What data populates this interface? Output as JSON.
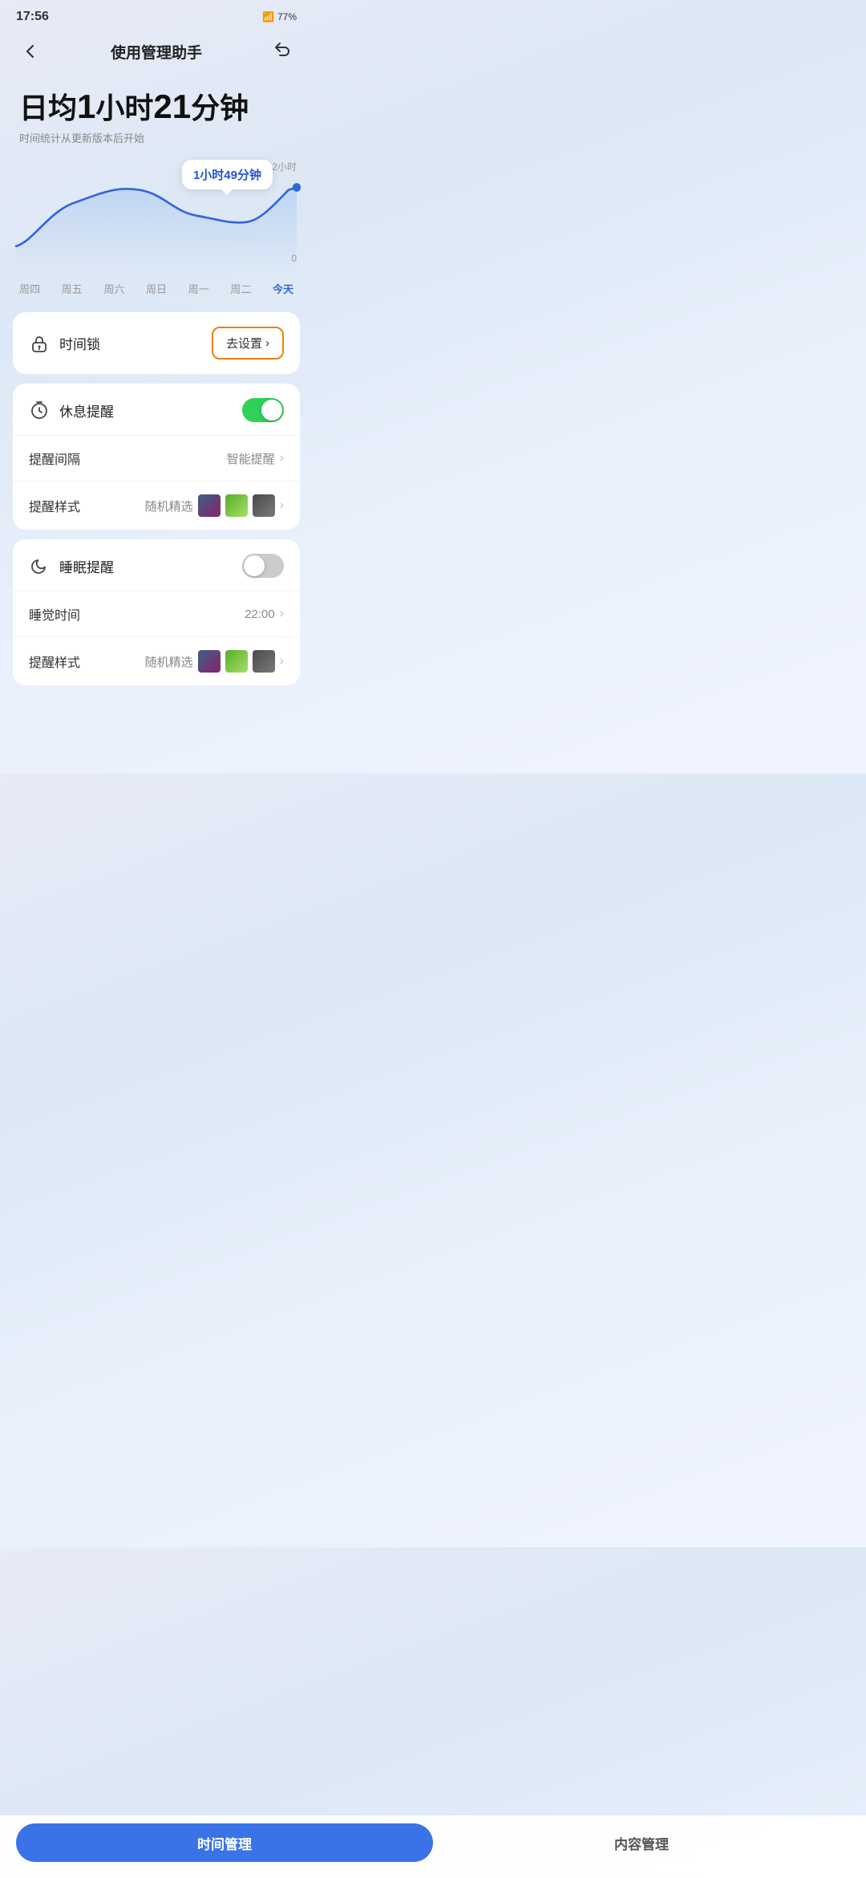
{
  "statusBar": {
    "time": "17:56",
    "battery": "77%"
  },
  "header": {
    "title": "使用管理助手",
    "backLabel": "‹",
    "shareLabel": "↗"
  },
  "dailyAvg": {
    "label": "日均1小时21分钟",
    "subtitle": "时间统计从更新版本后开始"
  },
  "chart": {
    "tooltip": "1小时49分钟",
    "yLabels": [
      "2小时",
      "0"
    ],
    "xLabels": [
      "周四",
      "周五",
      "周六",
      "周日",
      "周一",
      "周二",
      "今天"
    ]
  },
  "timeLock": {
    "icon": "🕐",
    "label": "时间锁",
    "action": "去设置",
    "chevron": ">"
  },
  "restReminder": {
    "icon": "⏱",
    "label": "休息提醒",
    "toggle": "on",
    "rows": [
      {
        "label": "提醒间隔",
        "value": "智能提醒",
        "hasChevron": true,
        "hasThumbs": false
      },
      {
        "label": "提醒样式",
        "value": "随机精选",
        "hasChevron": true,
        "hasThumbs": true
      }
    ]
  },
  "sleepReminder": {
    "icon": "🌙",
    "label": "睡眠提醒",
    "toggle": "off",
    "rows": [
      {
        "label": "睡觉时间",
        "value": "22:00",
        "hasChevron": true,
        "hasThumbs": false
      },
      {
        "label": "提醒样式",
        "value": "随机精选",
        "hasChevron": true,
        "hasThumbs": true
      }
    ]
  },
  "bottomBar": {
    "tabs": [
      {
        "label": "时间管理",
        "active": true
      },
      {
        "label": "内容管理",
        "active": false
      }
    ]
  }
}
